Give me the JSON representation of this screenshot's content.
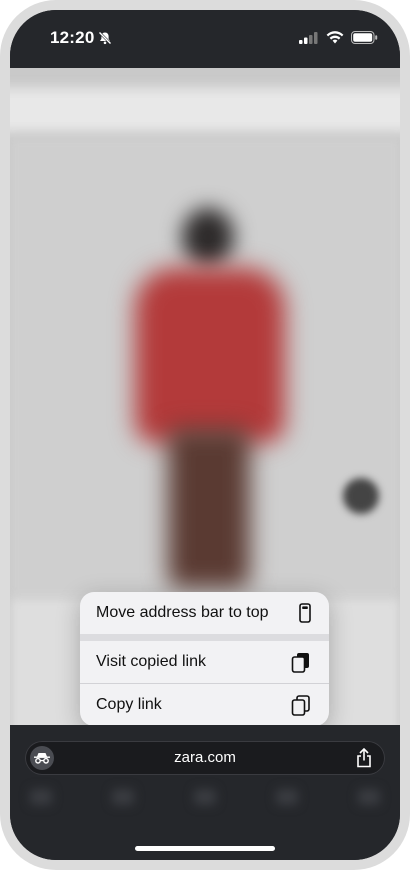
{
  "status_bar": {
    "time": "12:20",
    "icons": [
      "bell-slash-icon",
      "cellular-icon",
      "wifi-icon",
      "battery-icon"
    ]
  },
  "menu": {
    "items": [
      {
        "label": "Move address bar to top",
        "icon": "address-bar-top-icon"
      },
      {
        "label": "Visit copied link",
        "icon": "copied-link-icon"
      },
      {
        "label": "Copy link",
        "icon": "copy-icon"
      }
    ]
  },
  "address_bar": {
    "url": "zara.com",
    "left_icon": "incognito-icon",
    "right_icon": "share-icon"
  },
  "colors": {
    "chrome": "#25272b",
    "menu_bg": "#f2f2f4",
    "jacket": "#b33a3a"
  }
}
